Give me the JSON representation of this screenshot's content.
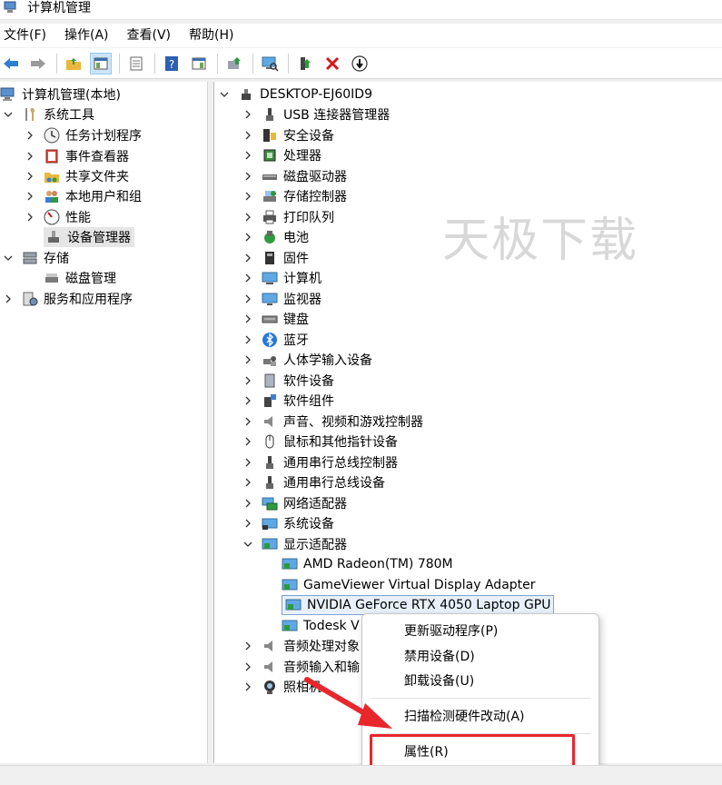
{
  "window": {
    "title": "计算机管理"
  },
  "menubar": {
    "items": [
      "文件(F)",
      "操作(A)",
      "查看(V)",
      "帮助(H)"
    ]
  },
  "toolbar": {
    "buttons": [
      "back-icon",
      "forward-icon",
      "up-folder-icon",
      "show-tree-icon",
      "properties-sheet-icon",
      "help-icon",
      "show-pane-icon",
      "update-driver-icon",
      "scan-hardware-icon",
      "enable-device-icon",
      "uninstall-icon",
      "disable-device-icon"
    ]
  },
  "left_tree": {
    "root": "计算机管理(本地)",
    "system_tools": "系统工具",
    "task_scheduler": "任务计划程序",
    "event_viewer": "事件查看器",
    "shared_folders": "共享文件夹",
    "local_users": "本地用户和组",
    "performance": "性能",
    "device_manager": "设备管理器",
    "storage": "存储",
    "disk_management": "磁盘管理",
    "services_apps": "服务和应用程序"
  },
  "device_tree": {
    "computer": "DESKTOP-EJ60ID9",
    "categories": [
      "USB 连接器管理器",
      "安全设备",
      "处理器",
      "磁盘驱动器",
      "存储控制器",
      "打印队列",
      "电池",
      "固件",
      "计算机",
      "监视器",
      "键盘",
      "蓝牙",
      "人体学输入设备",
      "软件设备",
      "软件组件",
      "声音、视频和游戏控制器",
      "鼠标和其他指针设备",
      "通用串行总线控制器",
      "通用串行总线设备",
      "网络适配器",
      "系统设备",
      "显示适配器"
    ],
    "display_adapters": [
      "AMD Radeon(TM) 780M",
      "GameViewer Virtual Display Adapter",
      "NVIDIA GeForce RTX 4050 Laptop GPU",
      "Todesk V"
    ],
    "after": [
      "音频处理对象",
      "音频输入和输",
      "照相机"
    ]
  },
  "watermark": "天极下载",
  "context_menu": {
    "update_driver": "更新驱动程序(P)",
    "disable": "禁用设备(D)",
    "uninstall": "卸载设备(U)",
    "scan": "扫描检测硬件改动(A)",
    "properties": "属性(R)"
  },
  "colors": {
    "highlight": "#e8262b",
    "selection": "#e5e5e5",
    "accent": "#0078d7"
  }
}
